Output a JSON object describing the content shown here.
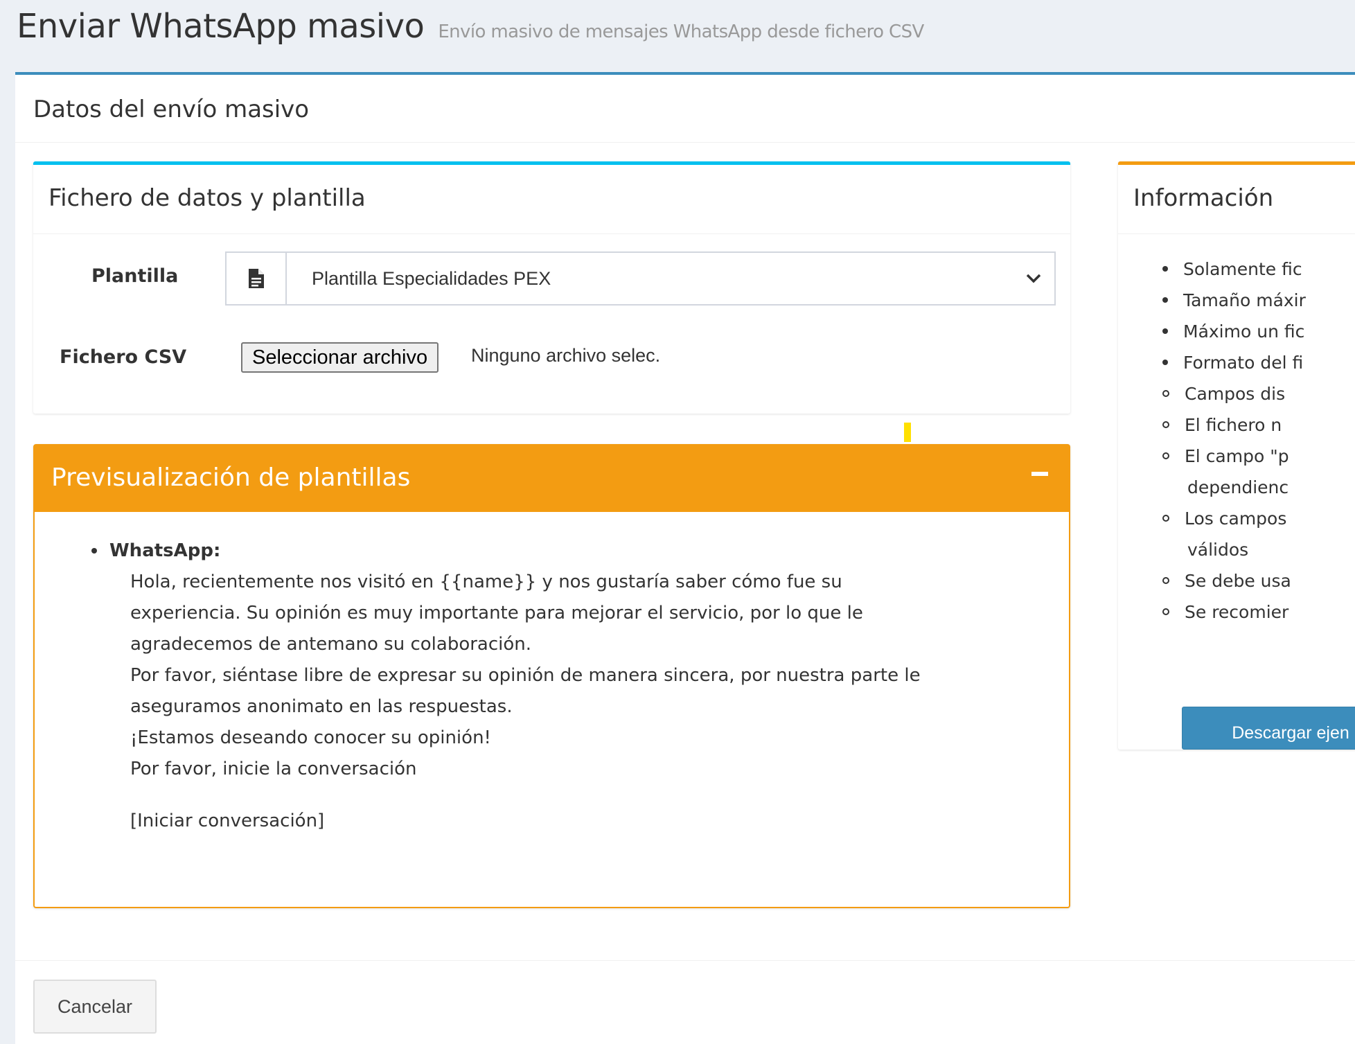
{
  "header": {
    "title": "Enviar WhatsApp masivo",
    "subtitle": "Envío masivo de mensajes WhatsApp desde fichero CSV"
  },
  "main_box": {
    "title": "Datos del envío masivo"
  },
  "data_box": {
    "title": "Fichero de datos y plantilla",
    "template_label": "Plantilla",
    "template_icon": "file-icon",
    "template_value": "Plantilla Especialidades PEX",
    "csv_label": "Fichero CSV",
    "file_button": "Seleccionar archivo",
    "file_status": "Ninguno archivo selec."
  },
  "preview_box": {
    "title": "Previsualización de plantillas",
    "collapse": "−",
    "channel": "WhatsApp:",
    "lines": [
      "Hola, recientemente nos visitó en {{name}} y nos gustaría saber cómo fue su",
      "experiencia. Su opinión es muy importante para mejorar el servicio, por lo que le",
      "agradecemos de antemano su colaboración.",
      "Por favor, siéntase libre de expresar su opinión de manera sincera, por nuestra parte le",
      "aseguramos anonimato en las respuestas.",
      "¡Estamos deseando conocer su opinión!",
      "Por favor, inicie la conversación",
      "",
      "[Iniciar conversación]"
    ]
  },
  "info_box": {
    "title": "Información",
    "items": [
      {
        "text": "Solamente fic",
        "level": 1
      },
      {
        "text": "Tamaño máxir",
        "level": 1
      },
      {
        "text": "Máximo un fic",
        "level": 1
      },
      {
        "text": "Formato del fi",
        "level": 1
      },
      {
        "text": "Campos dis",
        "level": 2
      },
      {
        "text": "El fichero n",
        "level": 2
      },
      {
        "text": "El campo \"p",
        "level": 2
      },
      {
        "text": "dependienc",
        "level": 3
      },
      {
        "text": "Los campos",
        "level": 2
      },
      {
        "text": "válidos",
        "level": 3
      },
      {
        "text": "Se debe usa",
        "level": 2
      },
      {
        "text": "Se recomier",
        "level": 2
      }
    ],
    "download_button": "Descargar ejen"
  },
  "footer": {
    "cancel_button": "Cancelar"
  },
  "colors": {
    "primary": "#3c8dbc",
    "info": "#00c0ef",
    "warning": "#f39c12",
    "background": "#ecf0f5"
  }
}
